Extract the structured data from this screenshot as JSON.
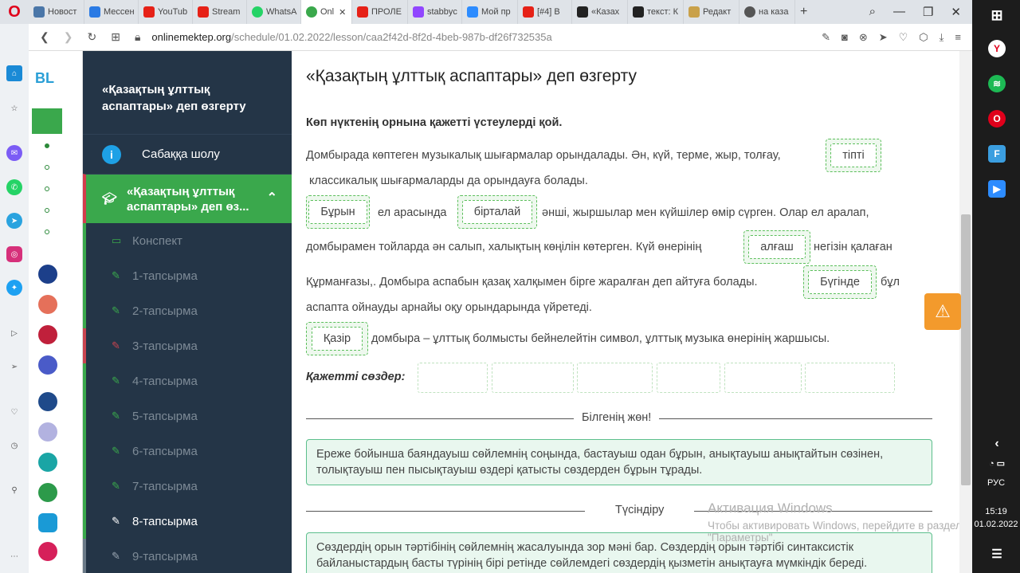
{
  "browser": {
    "tabs": [
      "Новост",
      "Мессен",
      "YouTub",
      "Stream",
      "WhatsA",
      "Onl",
      "ПРОЛЕ",
      "stabbyc",
      "Мой пр",
      "[#4] B",
      "«Казах",
      "текст: К",
      "Редакт",
      "на каза"
    ],
    "active_tab_close": "✕",
    "url_host": "onlinemektep.org",
    "url_path": "/schedule/01.02.2022/lesson/caa2f42d-8f2d-4beb-987b-df26f732535a"
  },
  "bilim": {
    "logo": "BL"
  },
  "sidebar": {
    "lesson_title": "«Қазақтың ұлттық аспаптары» деп өзгерту",
    "overview": "Сабаққа шолу",
    "current_item": "«Қазақтың ұлттық аспаптары» деп өз...",
    "items": [
      {
        "label": "Конспект"
      },
      {
        "label": "1-тапсырма"
      },
      {
        "label": "2-тапсырма"
      },
      {
        "label": "3-тапсырма"
      },
      {
        "label": "4-тапсырма"
      },
      {
        "label": "5-тапсырма"
      },
      {
        "label": "6-тапсырма"
      },
      {
        "label": "7-тапсырма"
      },
      {
        "label": "8-тапсырма"
      },
      {
        "label": "9-тапсырма"
      }
    ]
  },
  "main": {
    "title": "«Қазақтың ұлттық аспаптары» деп өзгерту",
    "instruction": "Көп нүктенің орнына қажетті үстеулерді қой.",
    "line1a": "Домбырада көптеген музыкалық шығармалар орындалады. Ән, күй, терме, жыр, толғау,",
    "line1b": "классикалық шығармаларды да орындауға болады.",
    "line2a": "ел арасында",
    "line2b": "әнші, жыршылар мен күйшілер өмір сүрген. Олар ел аралап,",
    "line3a": "домбырамен тойларда ән салып, халықтың көңілін көтерген. Күй өнерінің",
    "line3b": "негізін қалаған",
    "line4a": "Құрманғазы,. Домбыра аспабын қазақ халқымен бірге жаралған деп айтуға болады.",
    "line4b": "бұл",
    "line5": "аспапта ойнауды арнайы оқу орындарында үйретеді.",
    "line6": "домбыра – ұлттық болмысты бейнелейтін символ, ұлттық музыка өнерінің жаршысы.",
    "chips": {
      "tipti": "тіпті",
      "buryn": "Бұрын",
      "birtalai": "бірталай",
      "algash": "алғаш",
      "buginde": "Бүгінде",
      "kazir": "Қазір"
    },
    "needed_label": "Қажетті сөздер:",
    "know_label": "Білгенің жөн!",
    "know_text": "Ереже бойынша баяндауыш сөйлемнің соңында, бастауыш одан бұрын, анықтауыш анықтайтын сөзінен, толықтауыш пен пысықтауыш өздері қатысты сөздерден бұрын тұрады.",
    "explain_label": "Түсіндіру",
    "explain_text": "Сөздердің орын тәртібінің сөйлемнің жасалуында зор мәні бар. Сөздердің орын тәртібі синтаксистік байланыстардың басты түрінің бірі ретінде сөйлемдегі сөздердің қызметін анықтауға мүмкіндік береді."
  },
  "watermark": {
    "title": "Активация Windows",
    "text": "Чтобы активировать Windows, перейдите в раздел \"Параметры\"."
  },
  "taskbar": {
    "lang": "РУС",
    "time": "15:19",
    "date": "01.02.2022"
  },
  "colors": {
    "sidebar": "#243547",
    "accent_green": "#3aa84c",
    "accent_red": "#d43b4c",
    "warning": "#f39a2c"
  }
}
